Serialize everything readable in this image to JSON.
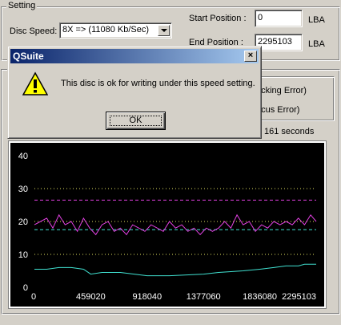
{
  "setting": {
    "group_label": "Setting",
    "disc_speed_label": "Disc Speed:",
    "disc_speed_value": "8X => (11080 Kb/Sec)",
    "start_position_label": "Start Position :",
    "start_position_value": "0",
    "start_unit": "LBA",
    "end_position_label": "End Position :",
    "end_position_value": "2295103",
    "end_unit": "LBA"
  },
  "results": {
    "tracking_error_fragment": "acking Error)",
    "focus_error_fragment": "ocus Error)",
    "time_fragment": "161 seconds"
  },
  "dialog": {
    "title": "QSuite",
    "message": "This disc is ok for writing under this speed setting.",
    "ok_label": "OK",
    "close_glyph": "×",
    "icon": "warning-icon"
  },
  "colors": {
    "titlebar": "#0a246a",
    "plot_bg": "#000000",
    "magenta_series": "#e040e0",
    "cyan_series": "#40e0d0",
    "dotted_grid": "#e0e060"
  },
  "chart_data": {
    "type": "line",
    "ylim": [
      0,
      40
    ],
    "yticks": [
      "0",
      "10",
      "20",
      "30",
      "40"
    ],
    "xlim": [
      0,
      2295103
    ],
    "xticks": [
      "0",
      "459020",
      "918040",
      "1377060",
      "1836080",
      "2295103"
    ],
    "grid_lines_y": [
      10,
      20,
      30
    ],
    "reference_lines": [
      {
        "name": "upper",
        "value": 26.5,
        "color": "#e040e0"
      },
      {
        "name": "lower",
        "value": 17.5,
        "color": "#40e0d0"
      }
    ],
    "series": [
      {
        "color": "#e040e0",
        "x": [
          0,
          50000,
          100000,
          150000,
          200000,
          250000,
          300000,
          350000,
          400000,
          450000,
          500000,
          550000,
          600000,
          650000,
          700000,
          750000,
          800000,
          850000,
          900000,
          950000,
          1000000,
          1050000,
          1100000,
          1150000,
          1200000,
          1250000,
          1300000,
          1350000,
          1400000,
          1450000,
          1500000,
          1550000,
          1600000,
          1650000,
          1700000,
          1750000,
          1800000,
          1850000,
          1900000,
          1950000,
          2000000,
          2050000,
          2100000,
          2150000,
          2200000,
          2250000,
          2295103
        ],
        "y": [
          19,
          20,
          21,
          18,
          22,
          19,
          20,
          17,
          21,
          18,
          16,
          19,
          20,
          17,
          18,
          16,
          19,
          18,
          17,
          19,
          18,
          17,
          20,
          18,
          19,
          17,
          18,
          16,
          18,
          17,
          18,
          20,
          18,
          22,
          19,
          20,
          17,
          19,
          18,
          20,
          19,
          20,
          19,
          21,
          19,
          22,
          20
        ]
      },
      {
        "color": "#40e0d0",
        "x": [
          0,
          100000,
          200000,
          300000,
          400000,
          459020,
          550000,
          700000,
          918040,
          1100000,
          1377060,
          1500000,
          1700000,
          1836080,
          1950000,
          2050000,
          2150000,
          2200000,
          2295103
        ],
        "y": [
          5.5,
          5.5,
          6,
          6,
          5.5,
          4,
          4.5,
          4.5,
          3.5,
          3.5,
          4,
          4.5,
          5,
          5.5,
          6,
          6.5,
          6.5,
          7,
          7
        ]
      }
    ]
  }
}
